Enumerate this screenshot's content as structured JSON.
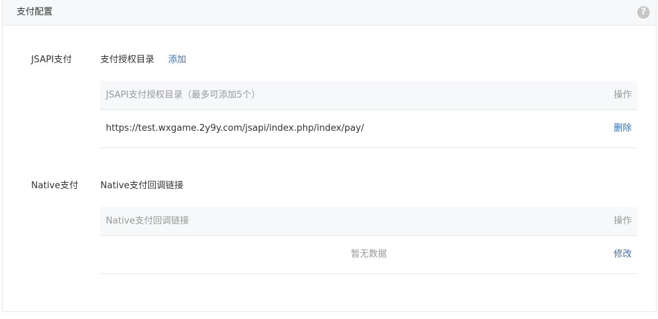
{
  "header": {
    "title": "支付配置",
    "help_icon": "question-circle-icon"
  },
  "jsapi": {
    "label": "JSAPI支付",
    "sub_title": "支付授权目录",
    "add_label": "添加",
    "table": {
      "col_main": "JSAPI支付授权目录（最多可添加5个）",
      "col_action": "操作",
      "rows": [
        {
          "url": "https://test.wxgame.2y9y.com/jsapi/index.php/index/pay/",
          "action": "删除"
        }
      ]
    }
  },
  "native": {
    "label": "Native支付",
    "sub_title": "Native支付回调链接",
    "table": {
      "col_main": "Native支付回调链接",
      "col_action": "操作",
      "empty_text": "暂无数据",
      "action": "修改"
    }
  },
  "colors": {
    "link": "#3a6eb6",
    "header_bg": "#f6f8f9",
    "border": "#e7e7eb",
    "muted_text": "#999999"
  }
}
